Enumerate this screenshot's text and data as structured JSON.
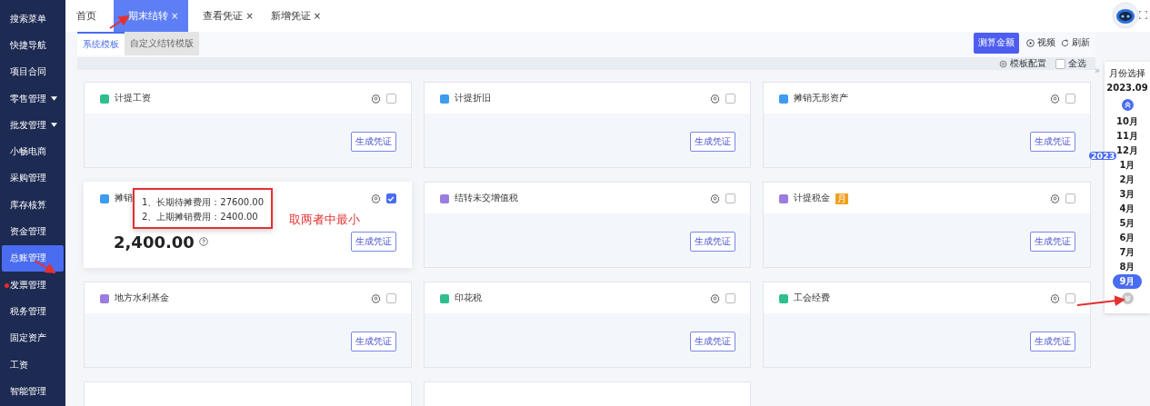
{
  "sidebar": {
    "items": [
      {
        "label": "搜索菜单",
        "selected": false,
        "has_submenu": false,
        "alert": false
      },
      {
        "label": "快捷导航",
        "selected": false,
        "has_submenu": false,
        "alert": false
      },
      {
        "label": "项目合同",
        "selected": false,
        "has_submenu": false,
        "alert": false
      },
      {
        "label": "零售管理",
        "selected": false,
        "has_submenu": true,
        "alert": false
      },
      {
        "label": "批发管理",
        "selected": false,
        "has_submenu": true,
        "alert": false
      },
      {
        "label": "小畅电商",
        "selected": false,
        "has_submenu": false,
        "alert": false
      },
      {
        "label": "采购管理",
        "selected": false,
        "has_submenu": false,
        "alert": false
      },
      {
        "label": "库存核算",
        "selected": false,
        "has_submenu": false,
        "alert": false
      },
      {
        "label": "资金管理",
        "selected": false,
        "has_submenu": false,
        "alert": false
      },
      {
        "label": "总账管理",
        "selected": true,
        "has_submenu": false,
        "alert": false
      },
      {
        "label": "发票管理",
        "selected": false,
        "has_submenu": false,
        "alert": true
      },
      {
        "label": "税务管理",
        "selected": false,
        "has_submenu": false,
        "alert": false
      },
      {
        "label": "固定资产",
        "selected": false,
        "has_submenu": false,
        "alert": false
      },
      {
        "label": "工资",
        "selected": false,
        "has_submenu": false,
        "alert": false
      },
      {
        "label": "智能管理",
        "selected": false,
        "has_submenu": false,
        "alert": false
      }
    ]
  },
  "tabs": [
    {
      "label": "首页",
      "selected": false,
      "closable": false
    },
    {
      "label": "期末结转",
      "selected": true,
      "closable": true
    },
    {
      "label": "查看凭证",
      "selected": false,
      "closable": true
    },
    {
      "label": "新增凭证",
      "selected": false,
      "closable": true
    }
  ],
  "close_glyph": "×",
  "sub_tabs": [
    {
      "label": "系统模板",
      "selected": true
    },
    {
      "label": "自定义结转模版",
      "selected": false
    }
  ],
  "toolbar": {
    "primary_button": "测算金额",
    "video": "视频",
    "refresh": "刷新",
    "template_config": "模板配置",
    "select_all": {
      "label": "全选",
      "checked": false
    }
  },
  "cards": [
    {
      "kind": "full",
      "title": "计提工资",
      "color": "#2fbf8f",
      "checked": false,
      "button": "生成凭证"
    },
    {
      "kind": "full",
      "title": "计提折旧",
      "color": "#3d9bf0",
      "checked": false,
      "button": "生成凭证"
    },
    {
      "kind": "full",
      "title": "摊销无形资产",
      "color": "#3d9bf0",
      "checked": false,
      "button": "生成凭证"
    },
    {
      "kind": "full",
      "title": "摊销",
      "color": "#3d9bf0",
      "checked": true,
      "button": "生成凭证",
      "amount": "2,400.00",
      "tooltip": [
        "1、长期待摊费用：27600.00",
        "2、上期摊销费用：2400.00"
      ],
      "annotation": "取两者中最小"
    },
    {
      "kind": "full",
      "title": "结转未交增值税",
      "color": "#9b7de0",
      "checked": false,
      "button": "生成凭证"
    },
    {
      "kind": "full",
      "title": "计提税金",
      "color": "#9b7de0",
      "checked": false,
      "button": "生成凭证",
      "badge": "月"
    },
    {
      "kind": "full",
      "title": "地方水利基金",
      "color": "#9b7de0",
      "checked": false,
      "button": "生成凭证"
    },
    {
      "kind": "full",
      "title": "印花税",
      "color": "#2fbf8f",
      "checked": false,
      "button": "生成凭证"
    },
    {
      "kind": "full",
      "title": "工会经费",
      "color": "#2fbf8f",
      "checked": false,
      "button": "生成凭证"
    },
    {
      "kind": "partial"
    },
    {
      "kind": "partial"
    }
  ],
  "month_picker": {
    "collapse_glyph": "»",
    "title": "月份选择",
    "current": "2023.09",
    "year_badge": "2023",
    "months": [
      {
        "label": "10月",
        "selected": false
      },
      {
        "label": "11月",
        "selected": false
      },
      {
        "label": "12月",
        "selected": false
      },
      {
        "label": "1月",
        "selected": false
      },
      {
        "label": "2月",
        "selected": false
      },
      {
        "label": "3月",
        "selected": false
      },
      {
        "label": "4月",
        "selected": false
      },
      {
        "label": "5月",
        "selected": false
      },
      {
        "label": "6月",
        "selected": false
      },
      {
        "label": "7月",
        "selected": false
      },
      {
        "label": "8月",
        "selected": false
      },
      {
        "label": "9月",
        "selected": true
      }
    ]
  }
}
